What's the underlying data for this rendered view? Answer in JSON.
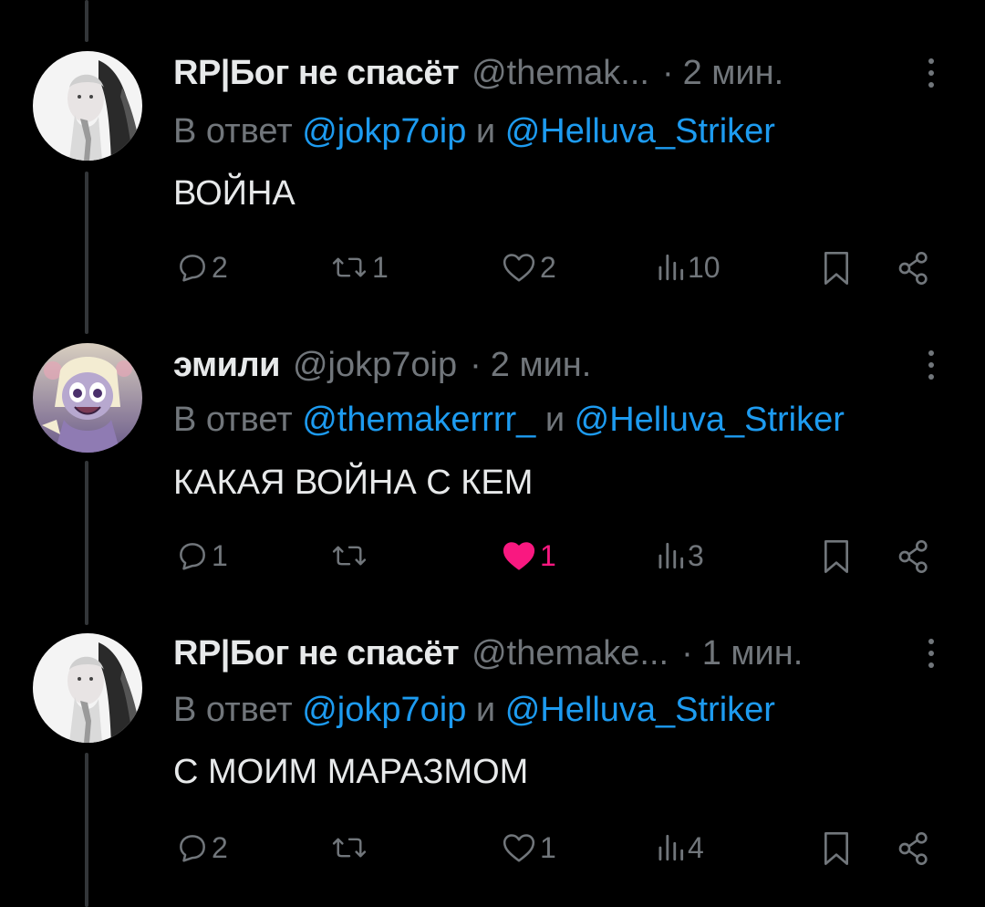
{
  "tweets": [
    {
      "name": "RP|Бог не спасёт",
      "handle": "@themak...",
      "dot": "·",
      "time": "2 мин.",
      "reply_prefix": "В ответ",
      "reply_mention1": "@jokp7oip",
      "reply_and": "и",
      "reply_mention2": "@Helluva_Striker",
      "text": "ВОЙНА",
      "replies": "2",
      "retweets": "1",
      "likes": "2",
      "views": "10",
      "liked": false,
      "avatar_icon": "avatar-gray-haired-character"
    },
    {
      "name": "эмили",
      "handle": "@jokp7oip",
      "dot": "·",
      "time": "2 мин.",
      "reply_prefix": "В ответ",
      "reply_mention1": "@themakerrrr_",
      "reply_and": "и",
      "reply_mention2": "@Helluva_Striker",
      "text": "КАКАЯ ВОЙНА С КЕМ",
      "replies": "1",
      "retweets": "",
      "likes": "1",
      "views": "3",
      "liked": true,
      "avatar_icon": "avatar-purple-cartoon-character"
    },
    {
      "name": "RP|Бог не спасёт",
      "handle": "@themake...",
      "dot": "·",
      "time": "1 мин.",
      "reply_prefix": "В ответ",
      "reply_mention1": "@jokp7oip",
      "reply_and": "и",
      "reply_mention2": "@Helluva_Striker",
      "text": "С МОИМ МАРАЗМОМ",
      "replies": "2",
      "retweets": "",
      "likes": "1",
      "views": "4",
      "liked": false,
      "avatar_icon": "avatar-gray-haired-character"
    }
  ],
  "colors": {
    "background": "#000000",
    "text": "#e7e9ea",
    "muted": "#71767b",
    "mention": "#1d9bf0",
    "like": "#f91880",
    "thread_line": "#333639"
  }
}
